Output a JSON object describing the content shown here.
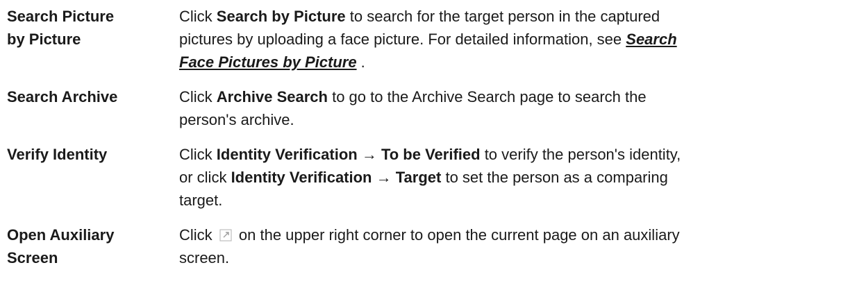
{
  "rows": [
    {
      "term_line1": "Search Picture",
      "term_line2": "by Picture",
      "line1_pre": "Click ",
      "line1_bold": "Search by Picture",
      "line1_post": " to search for the target person in the captured",
      "line2_pre": "pictures by uploading a face picture. For detailed information, see ",
      "link_part1": "Search",
      "link_part2": "Face Pictures by Picture",
      "line3_post": " ."
    },
    {
      "term_line1": "Search Archive",
      "line1_pre": "Click ",
      "line1_bold": "Archive Search",
      "line1_post": " to go to the Archive Search page to search the",
      "line2": "person's archive."
    },
    {
      "term_line1": "Verify Identity",
      "line1_pre": "Click ",
      "line1_bold_a": "Identity Verification",
      "arrow": " → ",
      "line1_bold_b": "To be Verified",
      "line1_post": " to verify the person's identity,",
      "line2_pre": "or click ",
      "line2_bold_a": "Identity Verification",
      "line2_bold_b": "Target",
      "line2_post": " to set the person as a comparing",
      "line3": "target."
    },
    {
      "term_line1": "Open Auxiliary",
      "term_line2": "Screen",
      "line1_pre": "Click ",
      "icon": "open-external-icon",
      "line1_post": " on the upper right corner to open the current page on an auxiliary",
      "line2": "screen."
    }
  ]
}
